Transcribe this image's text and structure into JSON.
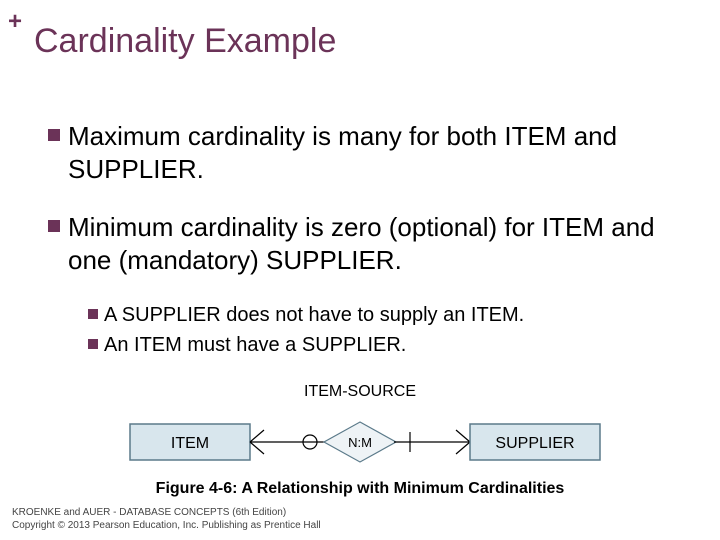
{
  "header": {
    "plus": "+",
    "title": "Cardinality Example"
  },
  "bullets": [
    "Maximum cardinality is many for both ITEM and SUPPLIER.",
    "Minimum cardinality is zero (optional) for ITEM and one (mandatory) SUPPLIER."
  ],
  "subbullets": [
    "A SUPPLIER does not have to supply an ITEM.",
    "An ITEM must have a SUPPLIER."
  ],
  "diagram": {
    "relationship_label": "ITEM-SOURCE",
    "left_entity": "ITEM",
    "cardinality": "N:M",
    "right_entity": "SUPPLIER"
  },
  "caption": "Figure 4-6:  A Relationship with Minimum Cardinalities",
  "footer": {
    "line1": "KROENKE and AUER -  DATABASE CONCEPTS (6th Edition)",
    "line2": "Copyright © 2013 Pearson Education, Inc. Publishing as Prentice Hall"
  }
}
